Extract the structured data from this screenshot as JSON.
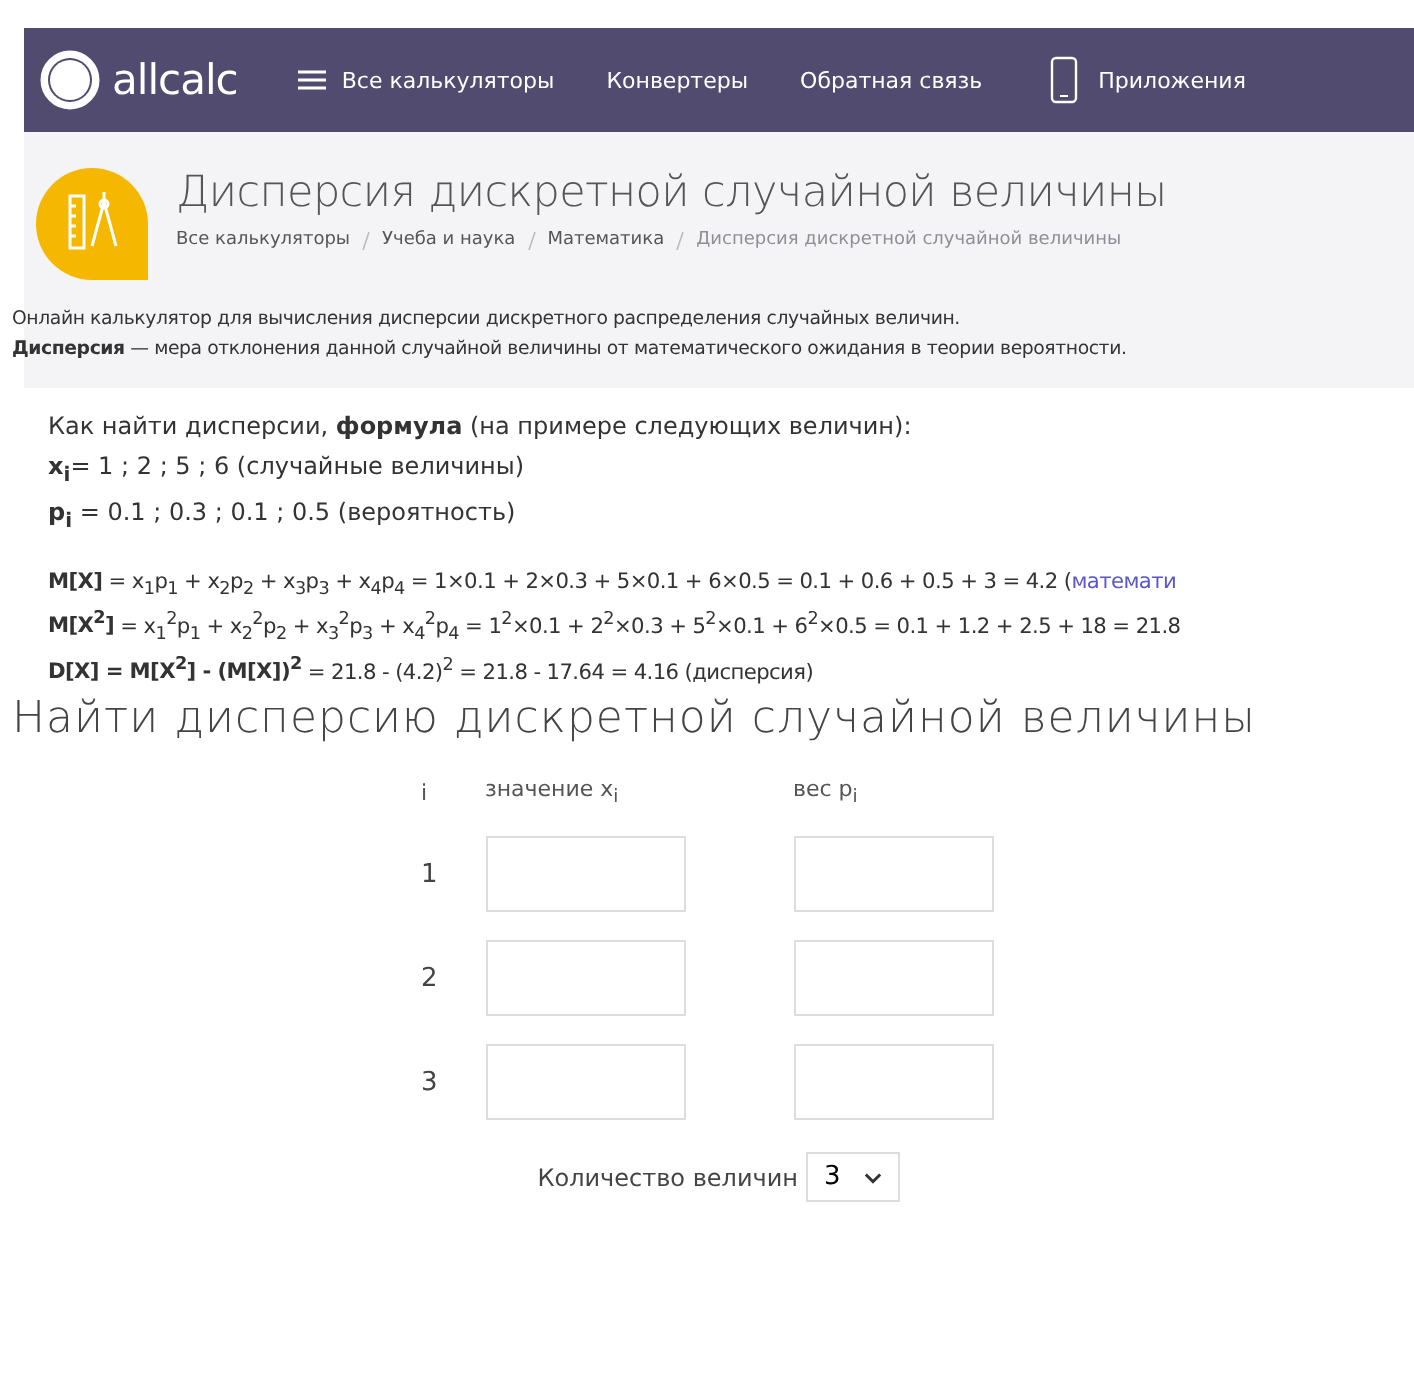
{
  "header": {
    "logo_text": "allcalc",
    "nav": [
      {
        "label": "Все калькуляторы",
        "kind": "menu"
      },
      {
        "label": "Конвертеры",
        "kind": "link"
      },
      {
        "label": "Обратная связь",
        "kind": "link"
      },
      {
        "label": "Приложения",
        "kind": "apps"
      }
    ]
  },
  "page_title": "Дисперсия дискретной случайной величины",
  "breadcrumbs": [
    {
      "label": "Все калькуляторы",
      "current": false
    },
    {
      "label": "Учеба и наука",
      "current": false
    },
    {
      "label": "Математика",
      "current": false
    },
    {
      "label": "Дисперсия дискретной случайной величины",
      "current": true
    }
  ],
  "intro": [
    "Онлайн калькулятор для вычисления дисперсии дискретного распределения случайных величин.",
    "**Дисперсия** — мера отклонения данной случайной величины от математического ожидания в теории вероятности."
  ],
  "howto": [
    "Как найти дисперсии, **формула** (на примере следующих величин):",
    "**x$_{i}$**= 1 ; 2 ; 5 ; 6 (случайные величины)",
    "**p$_{i}$** = 0.1 ; 0.3 ; 0.1 ; 0.5 (вероятность)"
  ],
  "formulas": [
    {
      "text": "**M[X]** = x$_{1}$p$_{1}$ + x$_{2}$p$_{2}$ + x$_{3}$p$_{3}$ + x$_{4}$p$_{4}$ = 1×0.1 + 2×0.3 + 5×0.1 + 6×0.5 = 0.1 + 0.6 + 0.5 + 3 = 4.2 (",
      "link": "математи"
    },
    {
      "text": "**M[X$^{2}$]** = x$_{1}$$^{2}$p$_{1}$ + x$_{2}$$^{2}$p$_{2}$ + x$_{3}$$^{2}$p$_{3}$ + x$_{4}$$^{2}$p$_{4}$ = 1$^{2}$×0.1 + 2$^{2}$×0.3 + 5$^{2}$×0.1 + 6$^{2}$×0.5 = 0.1 + 1.2 + 2.5 + 18 = 21.8"
    },
    {
      "text": "**D[X] = M[X$^{2}$] - (M[X])$^{2}$** = 21.8 - (4.2)$^{2}$ = 21.8 - 17.64 = 4.16 (дисперсия)"
    }
  ],
  "calculator": {
    "title": "Найти дисперсию дискретной случайной величины",
    "columns": [
      "i",
      "значение x$_{i}$",
      "вес p$_{i}$"
    ],
    "rows": [
      {
        "index": "1"
      },
      {
        "index": "2"
      },
      {
        "index": "3"
      }
    ],
    "count_label": "Количество величин",
    "count_value": "3"
  }
}
